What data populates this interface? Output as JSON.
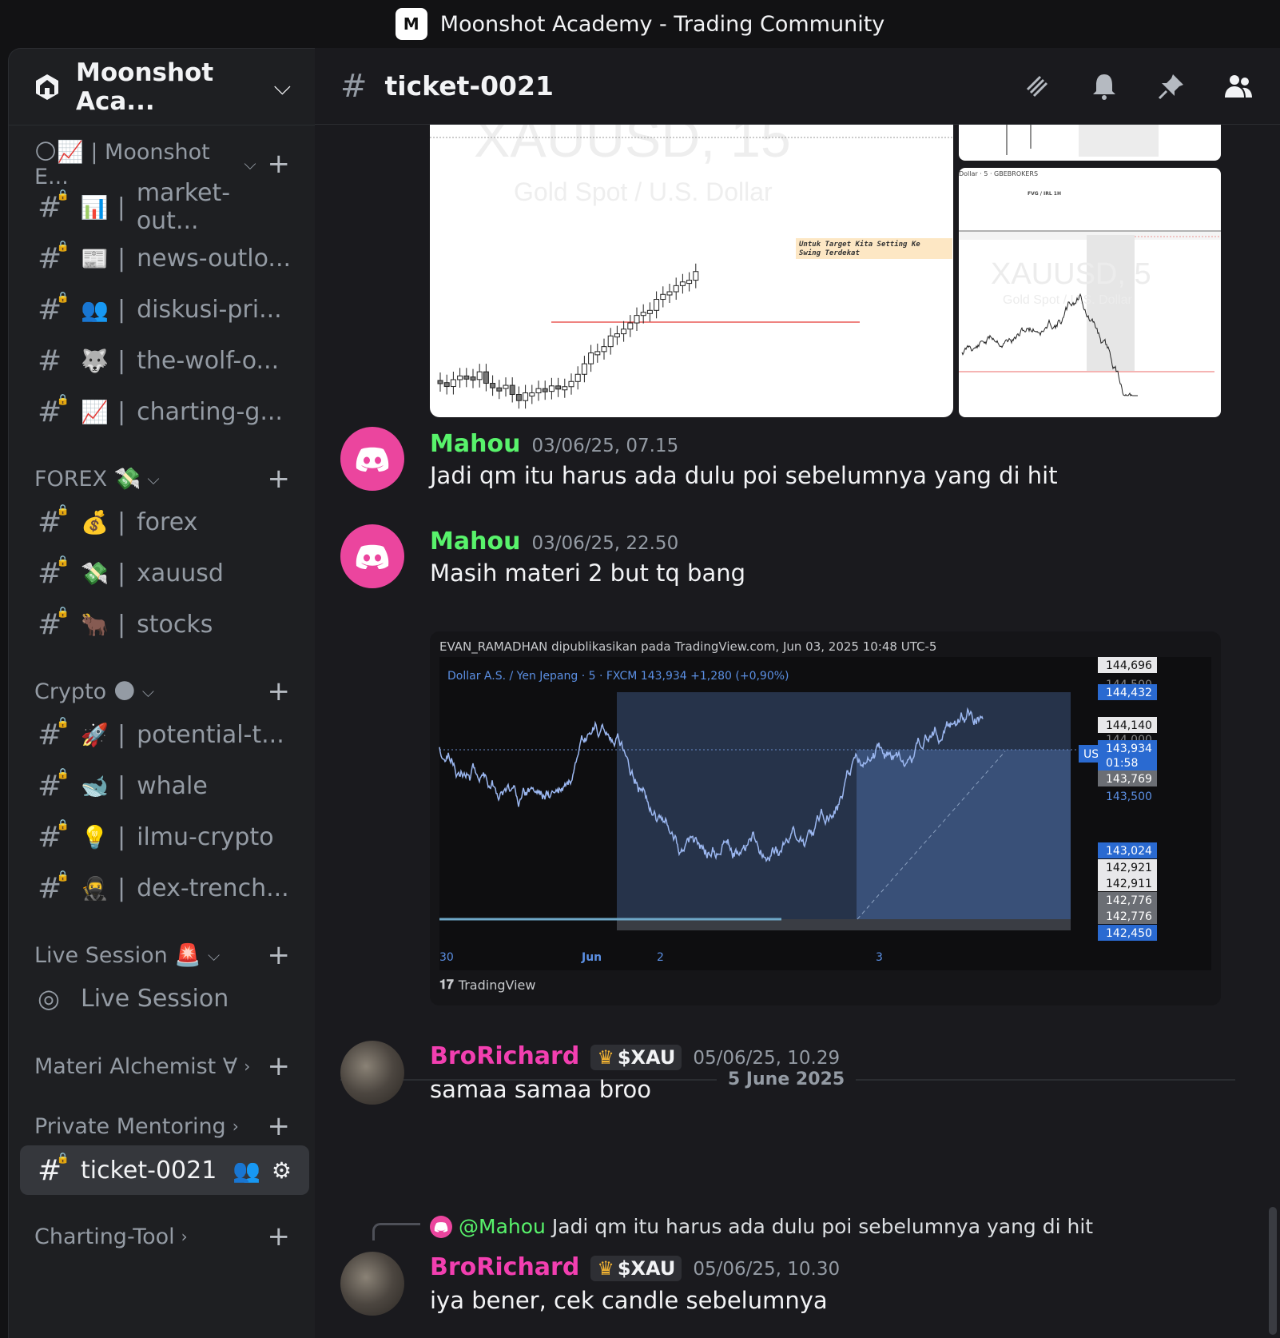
{
  "window": {
    "title": "Moonshot Academy - Trading Community",
    "app_icon_label": "M"
  },
  "sidebar": {
    "server_name": "Moonshot Aca...",
    "categories": {
      "top": {
        "label": "🌕📈 | Moonshot E..."
      },
      "forex": {
        "label": "FOREX 💸"
      },
      "crypto": {
        "label": "Crypto 🌑"
      },
      "live": {
        "label": "Live Session 🚨"
      },
      "materi": {
        "label": "Materi Alchemist ∀"
      },
      "mentoring": {
        "label": "Private Mentoring"
      },
      "charting": {
        "label": "Charting-Tool"
      }
    },
    "channels": [
      {
        "emoji": "📊",
        "name": "market-out..."
      },
      {
        "emoji": "📰",
        "name": "news-outlo..."
      },
      {
        "emoji": "👥",
        "name": "diskusi-pri..."
      },
      {
        "emoji": "🐺",
        "name": "the-wolf-o..."
      },
      {
        "emoji": "📈",
        "name": "charting-g..."
      },
      {
        "emoji": "💰",
        "name": "forex"
      },
      {
        "emoji": "💸",
        "name": "xauusd"
      },
      {
        "emoji": "🐂",
        "name": "stocks"
      },
      {
        "emoji": "🚀",
        "name": "potential-t..."
      },
      {
        "emoji": "🐋",
        "name": "whale"
      },
      {
        "emoji": "💡",
        "name": "ilmu-crypto"
      },
      {
        "emoji": "🥷",
        "name": "dex-trench..."
      }
    ],
    "live_session": "Live Session",
    "active_channel": "ticket-0021",
    "separator": "|"
  },
  "header": {
    "channel_name": "ticket-0021"
  },
  "images": {
    "left_title": "XAUUSD, 15",
    "left_subtitle": "Gold Spot / U.S. Dollar",
    "left_note": "Untuk Target Kita Setting Ke Swing Terdekat",
    "right_header": "Dollar · 5 · GBEBROKERS",
    "right_sub": "FVG / IRL 1H",
    "right_title": "XAUUSD, 5",
    "right_subtitle": "Gold Spot / U.S. Dollar"
  },
  "messages": [
    {
      "user": "Mahou",
      "time": "03/06/25, 07.15",
      "text": "Jadi qm itu harus ada dulu poi sebelumnya yang di hit"
    },
    {
      "user": "Mahou",
      "time": "03/06/25, 22.50",
      "text": "Masih materi 2 but tq bang"
    },
    {
      "user": "BroRichard",
      "badge": "$XAU",
      "time": "05/06/25, 10.29",
      "text": "samaa samaa broo"
    },
    {
      "user": "BroRichard",
      "badge": "$XAU",
      "time": "05/06/25, 10.30",
      "text": "iya bener, cek candle sebelumnya"
    }
  ],
  "reply": {
    "mention": "@Mahou",
    "text": "Jadi qm itu harus ada dulu poi sebelumnya yang di hit"
  },
  "date_divider": "5 June 2025",
  "tv": {
    "caption": "EVAN_RAMADHAN dipublikasikan pada TradingView.com, Jun 03, 2025 10:48 UTC-5",
    "legend": "Dollar A.S. / Yen Jepang · 5 · FXCM  143,934  +1,280 (+0,90%)",
    "symbol_tag": "USDJPY",
    "countdown": "01:58",
    "footer": "TradingView",
    "price_labels": [
      "144,696",
      "144,500",
      "144,432",
      "144,140",
      "144,000",
      "143,934",
      "143,769",
      "143,500",
      "143,024",
      "142,921",
      "142,911",
      "142,776",
      "142,776",
      "142,450"
    ],
    "x_labels": [
      "30",
      "Jun",
      "2",
      "3"
    ]
  }
}
